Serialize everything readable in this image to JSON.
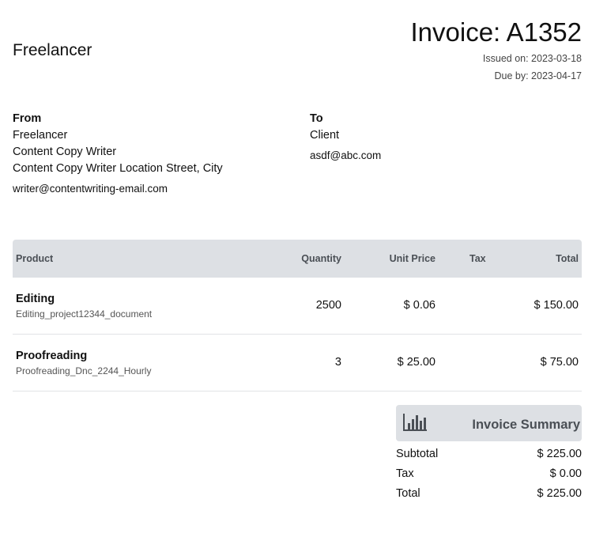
{
  "header": {
    "brand": "Freelancer",
    "title": "Invoice: A1352",
    "issued": "Issued on: 2023-03-18",
    "due": "Due by: 2023-04-17"
  },
  "from": {
    "label": "From",
    "name": "Freelancer",
    "title": "Content Copy Writer",
    "address": "Content Copy Writer Location Street, City",
    "email": "writer@contentwriting-email.com"
  },
  "to": {
    "label": "To",
    "name": "Client",
    "email": "asdf@abc.com"
  },
  "table": {
    "headers": {
      "product": "Product",
      "quantity": "Quantity",
      "unit_price": "Unit Price",
      "tax": "Tax",
      "total": "Total"
    },
    "rows": [
      {
        "name": "Editing",
        "desc": "Editing_project12344_document",
        "quantity": "2500",
        "unit_price": "$ 0.06",
        "tax": "",
        "total": "$ 150.00"
      },
      {
        "name": "Proofreading",
        "desc": "Proofreading_Dnc_2244_Hourly",
        "quantity": "3",
        "unit_price": "$ 25.00",
        "tax": "",
        "total": "$ 75.00"
      }
    ]
  },
  "summary": {
    "icon": "bar-chart-icon",
    "title": "Invoice Summary",
    "subtotal_label": "Subtotal",
    "subtotal": "$ 225.00",
    "tax_label": "Tax",
    "tax": "$ 0.00",
    "total_label": "Total",
    "total": "$ 225.00"
  }
}
